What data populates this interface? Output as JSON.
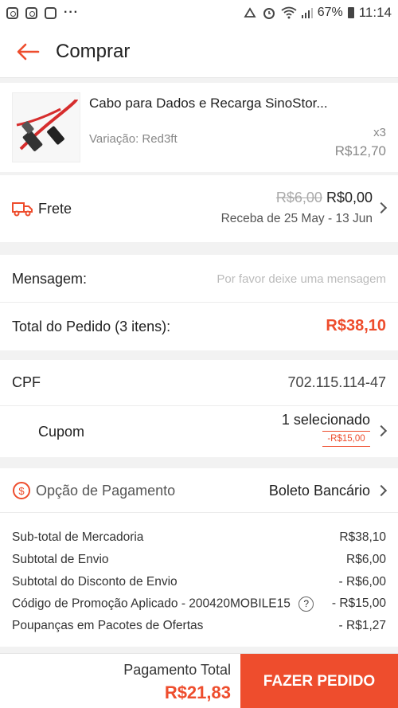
{
  "status_bar": {
    "battery": "67%",
    "time": "11:14",
    "left_icons": [
      "instagram-icon",
      "instagram-icon",
      "news-icon",
      "more-dots-icon"
    ],
    "right_icons": [
      "recycle-icon",
      "alarm-icon",
      "wifi-icon",
      "signal-icon",
      "battery-icon"
    ]
  },
  "header": {
    "title": "Comprar"
  },
  "product": {
    "name": "Cabo para Dados e Recarga SinoStor...",
    "variation": "Variação: Red3ft",
    "quantity": "x3",
    "price": "R$12,70"
  },
  "shipping": {
    "label": "Frete",
    "old_price": "R$6,00",
    "price": "R$0,00",
    "delivery": "Receba de 25 May - 13 Jun"
  },
  "message": {
    "label": "Mensagem:",
    "placeholder": "Por favor deixe uma mensagem"
  },
  "order_total": {
    "label": "Total do Pedido (3 itens):",
    "value": "R$38,10"
  },
  "cpf": {
    "label": "CPF",
    "value": "702.115.114-47"
  },
  "coupon": {
    "label": "Cupom",
    "selected": "1 selecionado",
    "discount": "-R$15,00"
  },
  "payment": {
    "label": "Opção de Pagamento",
    "method": "Boleto Bancário"
  },
  "summary": [
    {
      "label": "Sub-total de Mercadoria",
      "value": "R$38,10"
    },
    {
      "label": "Subtotal de Envio",
      "value": "R$6,00"
    },
    {
      "label": "Subtotal do Disconto de Envio",
      "value": "- R$6,00"
    },
    {
      "label": "Código de Promoção Aplicado - 200420MOBILE15",
      "value": "- R$15,00"
    },
    {
      "label": "Poupanças em Pacotes de Ofertas",
      "value": "- R$1,27"
    }
  ],
  "footer": {
    "total_label": "Pagamento Total",
    "total_value": "R$21,83",
    "button": "FAZER PEDIDO"
  },
  "colors": {
    "accent": "#ee4d2d",
    "accent_price": "#ee4d2d",
    "muted": "#888888"
  }
}
